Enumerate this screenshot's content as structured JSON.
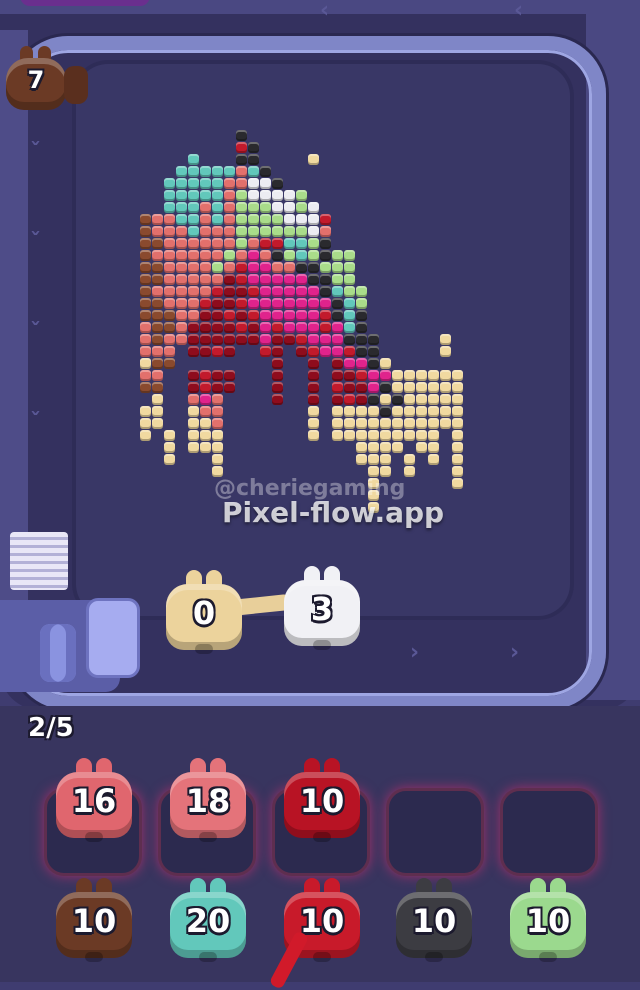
{
  "header": {
    "queue_count": "7",
    "queue_color": "#6b3a25"
  },
  "watermark": {
    "handle": "@cheriegaming",
    "site": "Pixel-flow.app"
  },
  "conveyor": [
    {
      "value": "0",
      "color": "#ecd39c"
    },
    {
      "value": "3",
      "color": "#f1f1f5"
    }
  ],
  "progress": "2/5",
  "slots": [
    {
      "value": "16",
      "color": "#e0666e"
    },
    {
      "value": "18",
      "color": "#e4737a"
    },
    {
      "value": "10",
      "color": "#b81324"
    },
    {
      "value": "",
      "color": ""
    },
    {
      "value": "",
      "color": ""
    }
  ],
  "queue": [
    {
      "value": "10",
      "color": "#6b3a25"
    },
    {
      "value": "20",
      "color": "#62c8bb"
    },
    {
      "value": "10",
      "color": "#c81a2a"
    },
    {
      "value": "10",
      "color": "#3c3c42"
    },
    {
      "value": "10",
      "color": "#9bd98e"
    }
  ],
  "palette": {
    "teal": "#62c8bb",
    "salmon": "#e2706c",
    "green": "#a9dc8a",
    "dark_red": "#8e0c1d",
    "red": "#c21a2c",
    "pink": "#e0238c",
    "cream": "#f0d9a0",
    "brown": "#8a4a2e",
    "black": "#2a2a2e",
    "white": "#ececf2"
  }
}
